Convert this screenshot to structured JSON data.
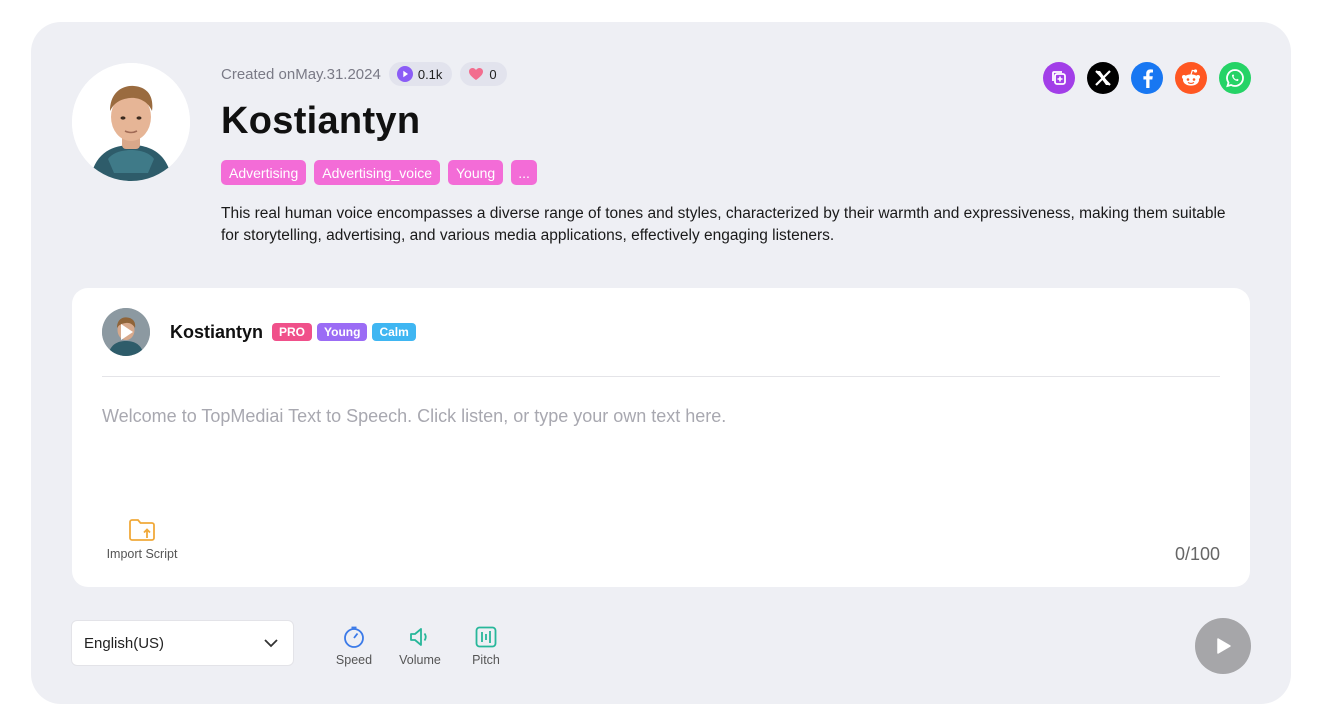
{
  "voice": {
    "created_label": "Created on",
    "created_date": "May.31.2024",
    "plays": "0.1k",
    "likes": "0",
    "name": "Kostiantyn",
    "tags": [
      "Advertising",
      "Advertising_voice",
      "Young",
      "..."
    ],
    "description": "This real human voice encompasses a diverse range of tones and styles, characterized by their warmth and expressiveness, making them suitable for storytelling, advertising, and various media applications, effectively engaging listeners."
  },
  "social": {
    "icons": [
      "copy-link-icon",
      "x-icon",
      "facebook-icon",
      "reddit-icon",
      "whatsapp-icon"
    ],
    "colors": {
      "copy": "#a23ee8",
      "x": "#000000",
      "facebook": "#1877f2",
      "reddit": "#ff5722",
      "whatsapp": "#25d366"
    }
  },
  "editor": {
    "voice_name": "Kostiantyn",
    "badges": [
      {
        "label": "PRO",
        "color": "#f0508a"
      },
      {
        "label": "Young",
        "color": "#9b6cf5"
      },
      {
        "label": "Calm",
        "color": "#3fb6f2"
      }
    ],
    "placeholder": "Welcome to TopMediai Text to Speech. Click listen, or type your own text here.",
    "import_label": "Import Script",
    "counter": "0/100"
  },
  "controls": {
    "language": "English(US)",
    "speed_label": "Speed",
    "volume_label": "Volume",
    "pitch_label": "Pitch"
  },
  "colors": {
    "tag": "#f36cd7",
    "card_bg": "#eeeff4",
    "play_disabled": "#a6a6a9"
  }
}
